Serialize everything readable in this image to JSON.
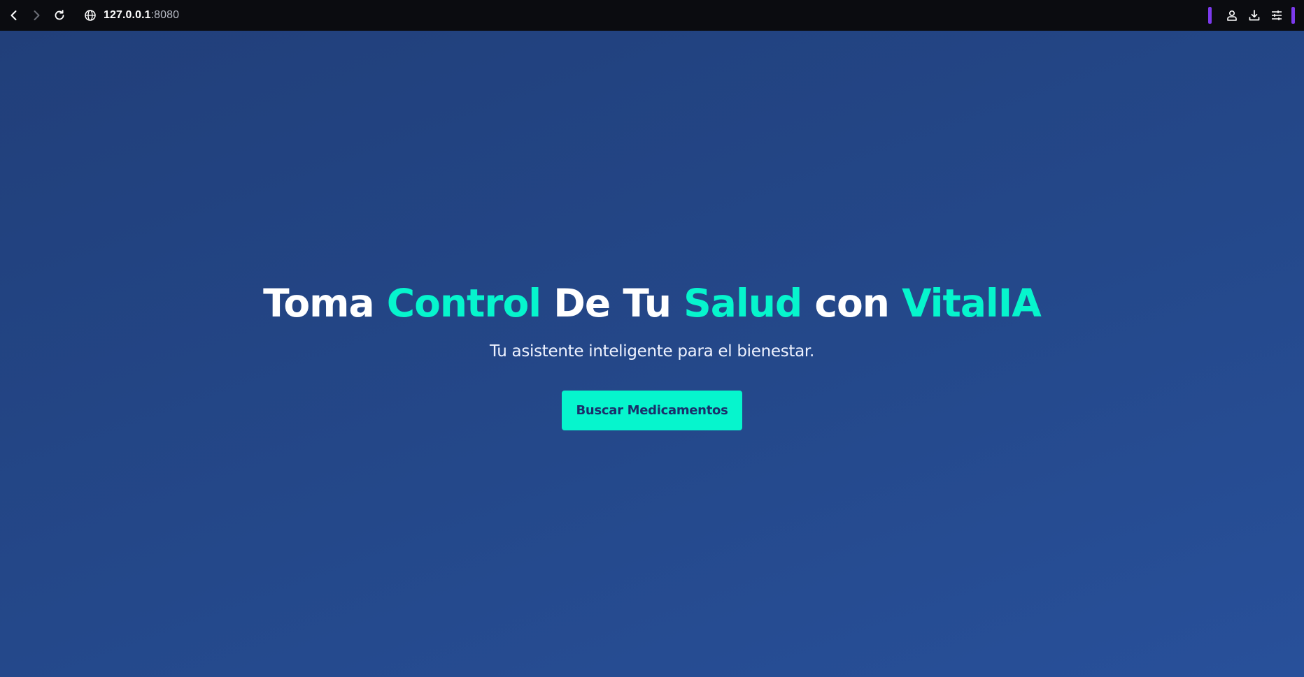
{
  "browser": {
    "url_host": "127.0.0.1",
    "url_port": ":8080",
    "icons": {
      "back": "chevron-left-icon",
      "forward": "chevron-right-icon",
      "reload": "reload-icon",
      "site": "globe-icon",
      "profile": "user-icon",
      "downloads": "download-icon",
      "menu": "sliders-icon"
    },
    "accent_color": "#7c3aed"
  },
  "hero": {
    "title": {
      "part1": "Toma ",
      "part2": "Control",
      "part3": " De Tu ",
      "part4": "Salud",
      "part5": " con ",
      "part6": "VitalIA"
    },
    "subtitle": "Tu asistente inteligente para el bienestar.",
    "cta_label": "Buscar Medicamentos"
  },
  "colors": {
    "background_start": "#213f7a",
    "background_end": "#28509a",
    "accent": "#06f5cd",
    "button_text": "#1a2f6b"
  }
}
